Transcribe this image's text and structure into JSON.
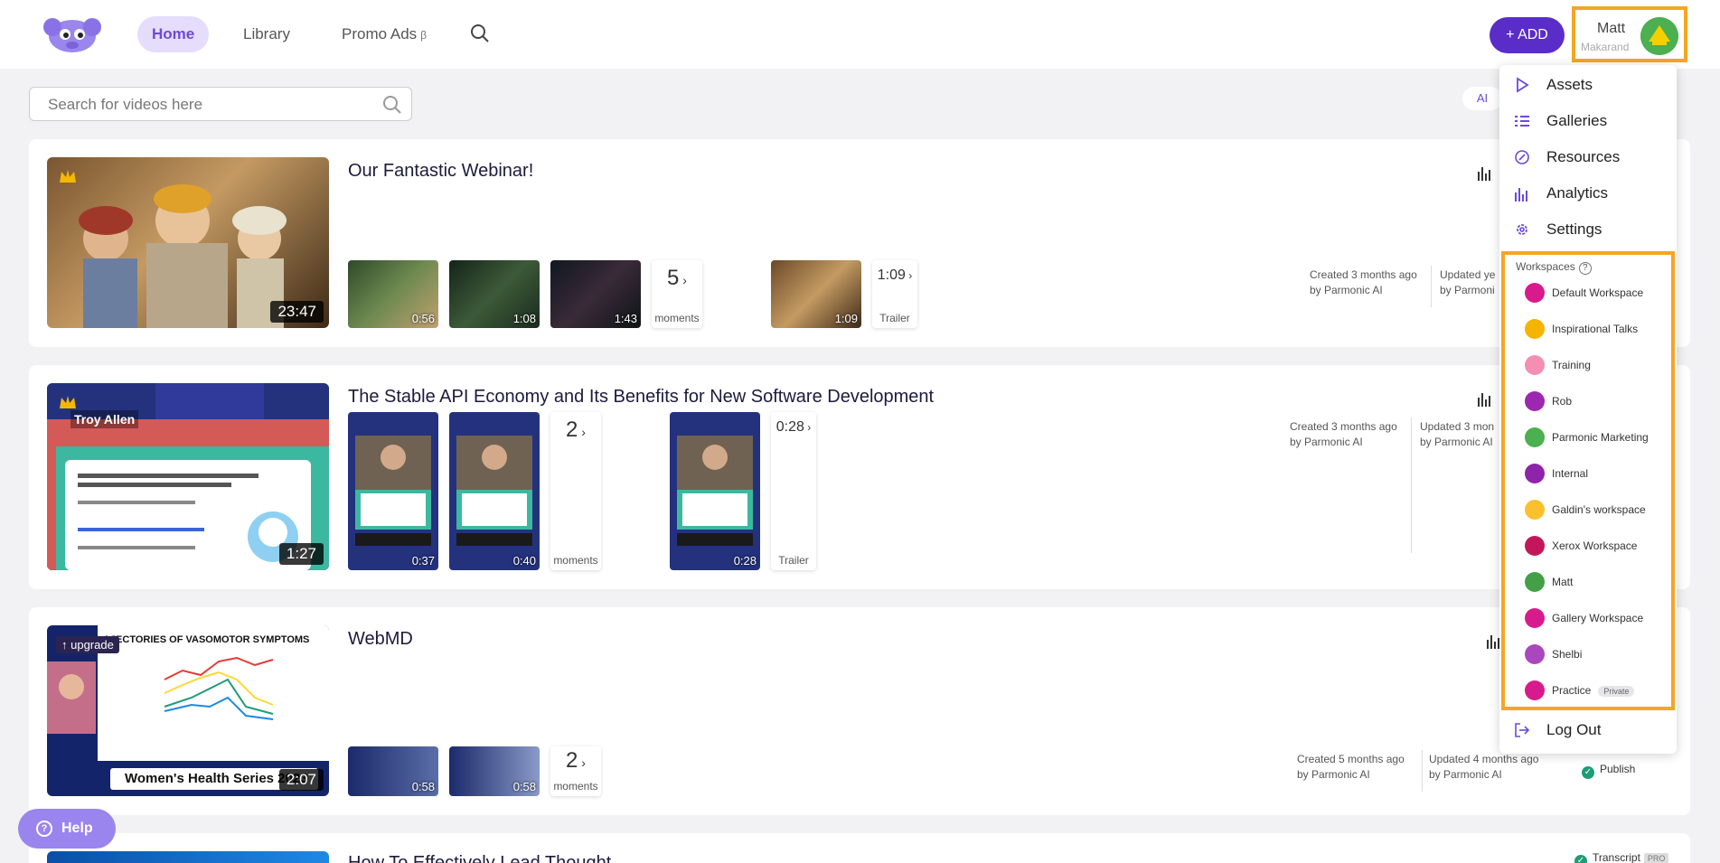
{
  "header": {
    "nav": [
      {
        "label": "Home"
      },
      {
        "label": "Library"
      },
      {
        "label": "Promo Ads",
        "beta": "β"
      }
    ],
    "add_label": "+ ADD",
    "user": {
      "name": "Matt",
      "sub": "Makarand"
    }
  },
  "search": {
    "placeholder": "Search for videos here",
    "filter_label": "AI"
  },
  "videos": [
    {
      "title": "Our Fantastic Webinar!",
      "duration": "23:47",
      "moments": [
        "0:56",
        "1:08",
        "1:43"
      ],
      "moment_count": "5",
      "moments_label": "moments",
      "trailer_duration": "1:09",
      "trailer_thumb_duration": "1:09",
      "trailer_label": "Trailer",
      "created": "Created 3 months ago",
      "created_by": "by Parmonic AI",
      "updated": "Updated ye",
      "updated_by": "by Parmoni"
    },
    {
      "title": "The Stable API Economy and Its Benefits for New Software Development",
      "duration": "1:27",
      "speaker": "Troy Allen",
      "moments": [
        "0:37",
        "0:40"
      ],
      "moment_count": "2",
      "moments_label": "moments",
      "trailer_duration": "0:28",
      "trailer_thumb_duration": "0:28",
      "trailer_label": "Trailer",
      "created": "Created 3 months ago",
      "created_by": "by Parmonic AI",
      "updated": "Updated 3 mon",
      "updated_by": "by Parmonic AI"
    },
    {
      "title": "WebMD",
      "duration": "2:07",
      "upgrade_label": "↑ upgrade",
      "thumb_heading": "AJECTORIES OF VASOMOTOR SYMPTOMS",
      "thumb_footer": "Women's Health Series 2023",
      "moments": [
        "0:58",
        "0:58"
      ],
      "moment_count": "2",
      "moments_label": "moments",
      "created": "Created 5 months ago",
      "created_by": "by Parmonic AI",
      "updated": "Updated 4 months ago",
      "updated_by": "by Parmonic AI",
      "publish_label": "Publish"
    },
    {
      "title": "How To Effectively Lead Thought",
      "transcript_label": "Transcript",
      "pro_label": "PRO"
    }
  ],
  "menu": {
    "items": [
      {
        "label": "Assets",
        "icon": "play-icon"
      },
      {
        "label": "Galleries",
        "icon": "list-icon"
      },
      {
        "label": "Resources",
        "icon": "link-icon"
      },
      {
        "label": "Analytics",
        "icon": "bar-chart-icon"
      },
      {
        "label": "Settings",
        "icon": "gear-icon"
      }
    ],
    "workspaces_label": "Workspaces",
    "workspaces": [
      {
        "label": "Default Workspace",
        "color": "#d81b8c"
      },
      {
        "label": "Inspirational Talks",
        "color": "#f5b400"
      },
      {
        "label": "Training",
        "color": "#f48fb1"
      },
      {
        "label": "Rob",
        "color": "#9c27b0"
      },
      {
        "label": "Parmonic Marketing",
        "color": "#4caf50"
      },
      {
        "label": "Internal",
        "color": "#8e24aa"
      },
      {
        "label": "Galdin's workspace",
        "color": "#fbc02d"
      },
      {
        "label": "Xerox Workspace",
        "color": "#c2185b"
      },
      {
        "label": "Matt",
        "color": "#43a047"
      },
      {
        "label": "Gallery Workspace",
        "color": "#d81b8c"
      },
      {
        "label": "Shelbi",
        "color": "#ab47bc"
      },
      {
        "label": "Practice",
        "color": "#d81b8c",
        "tag": "Private"
      }
    ],
    "logout_label": "Log Out"
  },
  "help_label": "Help"
}
